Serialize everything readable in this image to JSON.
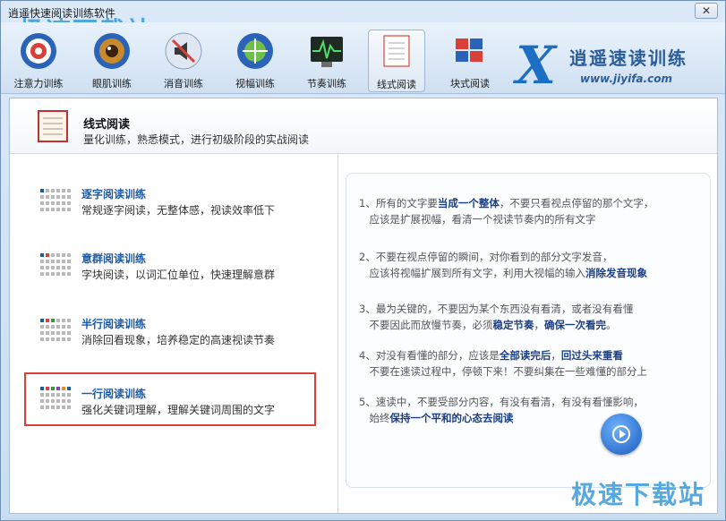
{
  "window": {
    "title": "逍遥快速阅读训练软件",
    "close_label": "✕",
    "watermark": "极速下载站"
  },
  "toolbar": {
    "tools": [
      {
        "label": "注意力训练",
        "icon": "target-icon"
      },
      {
        "label": "眼肌训练",
        "icon": "eye-icon"
      },
      {
        "label": "消音训练",
        "icon": "mute-icon"
      },
      {
        "label": "视幅训练",
        "icon": "expand-icon"
      },
      {
        "label": "节奏训练",
        "icon": "rhythm-monitor-icon"
      },
      {
        "label": "线式阅读",
        "icon": "book-icon"
      },
      {
        "label": "块式阅读",
        "icon": "blocks-icon"
      }
    ],
    "brand": {
      "name": "逍遥速读训练",
      "url": "www.jiyifa.com"
    }
  },
  "header": {
    "title": "线式阅读",
    "subtitle": "量化训练，熟悉模式，进行初级阶段的实战阅读"
  },
  "modes": [
    {
      "name": "逐字阅读训练",
      "desc": "常规逐字阅读，无整体感，视读效率低下"
    },
    {
      "name": "意群阅读训练",
      "desc": "字块阅读，以词汇位单位，快速理解意群"
    },
    {
      "name": "半行阅读训练",
      "desc": "消除回看现象，培养稳定的高速视读节奏"
    },
    {
      "name": "一行阅读训练",
      "desc": "强化关键词理解，理解关键词周围的文字"
    }
  ],
  "tips": [
    {
      "num": "1、",
      "l1a": "所有的文字要",
      "l1b": "当成一个整体",
      "l1c": "，不要只看视点停留的那个文字，",
      "l2": "应该是扩展视幅，看清一个视读节奏内的所有文字"
    },
    {
      "num": "2、",
      "l1": "不要在视点停留的瞬间，对你看到的部分文字发音，",
      "l2a": "应该将视幅扩展到所有文字，利用大视幅的输入",
      "l2b": "消除发音现象"
    },
    {
      "num": "3、",
      "l1": "最为关键的，不要因为某个东西没有看清，或者没有看懂",
      "l2a": "不要因此而放慢节奏，必须",
      "l2b": "稳定节奏",
      "l2c": "，",
      "l2d": "确保一次看完",
      "l2e": "。"
    },
    {
      "num": "4、",
      "l1a": "对没有看懂的部分，应该是",
      "l1b": "全部读完后",
      "l1c": "，",
      "l1d": "回过头来重看",
      "l2": "不要在速读过程中，停顿下来！不要纠集在一些难懂的部分上"
    },
    {
      "num": "5、",
      "l1": "速读中，不要受部分内容，有没有看清，有没有看懂影响，",
      "l2a": "始终",
      "l2b": "保持一个平和的心态去阅读"
    }
  ],
  "colors": {
    "accent": "#1b5aa8",
    "highlight_border": "#d9403a"
  }
}
